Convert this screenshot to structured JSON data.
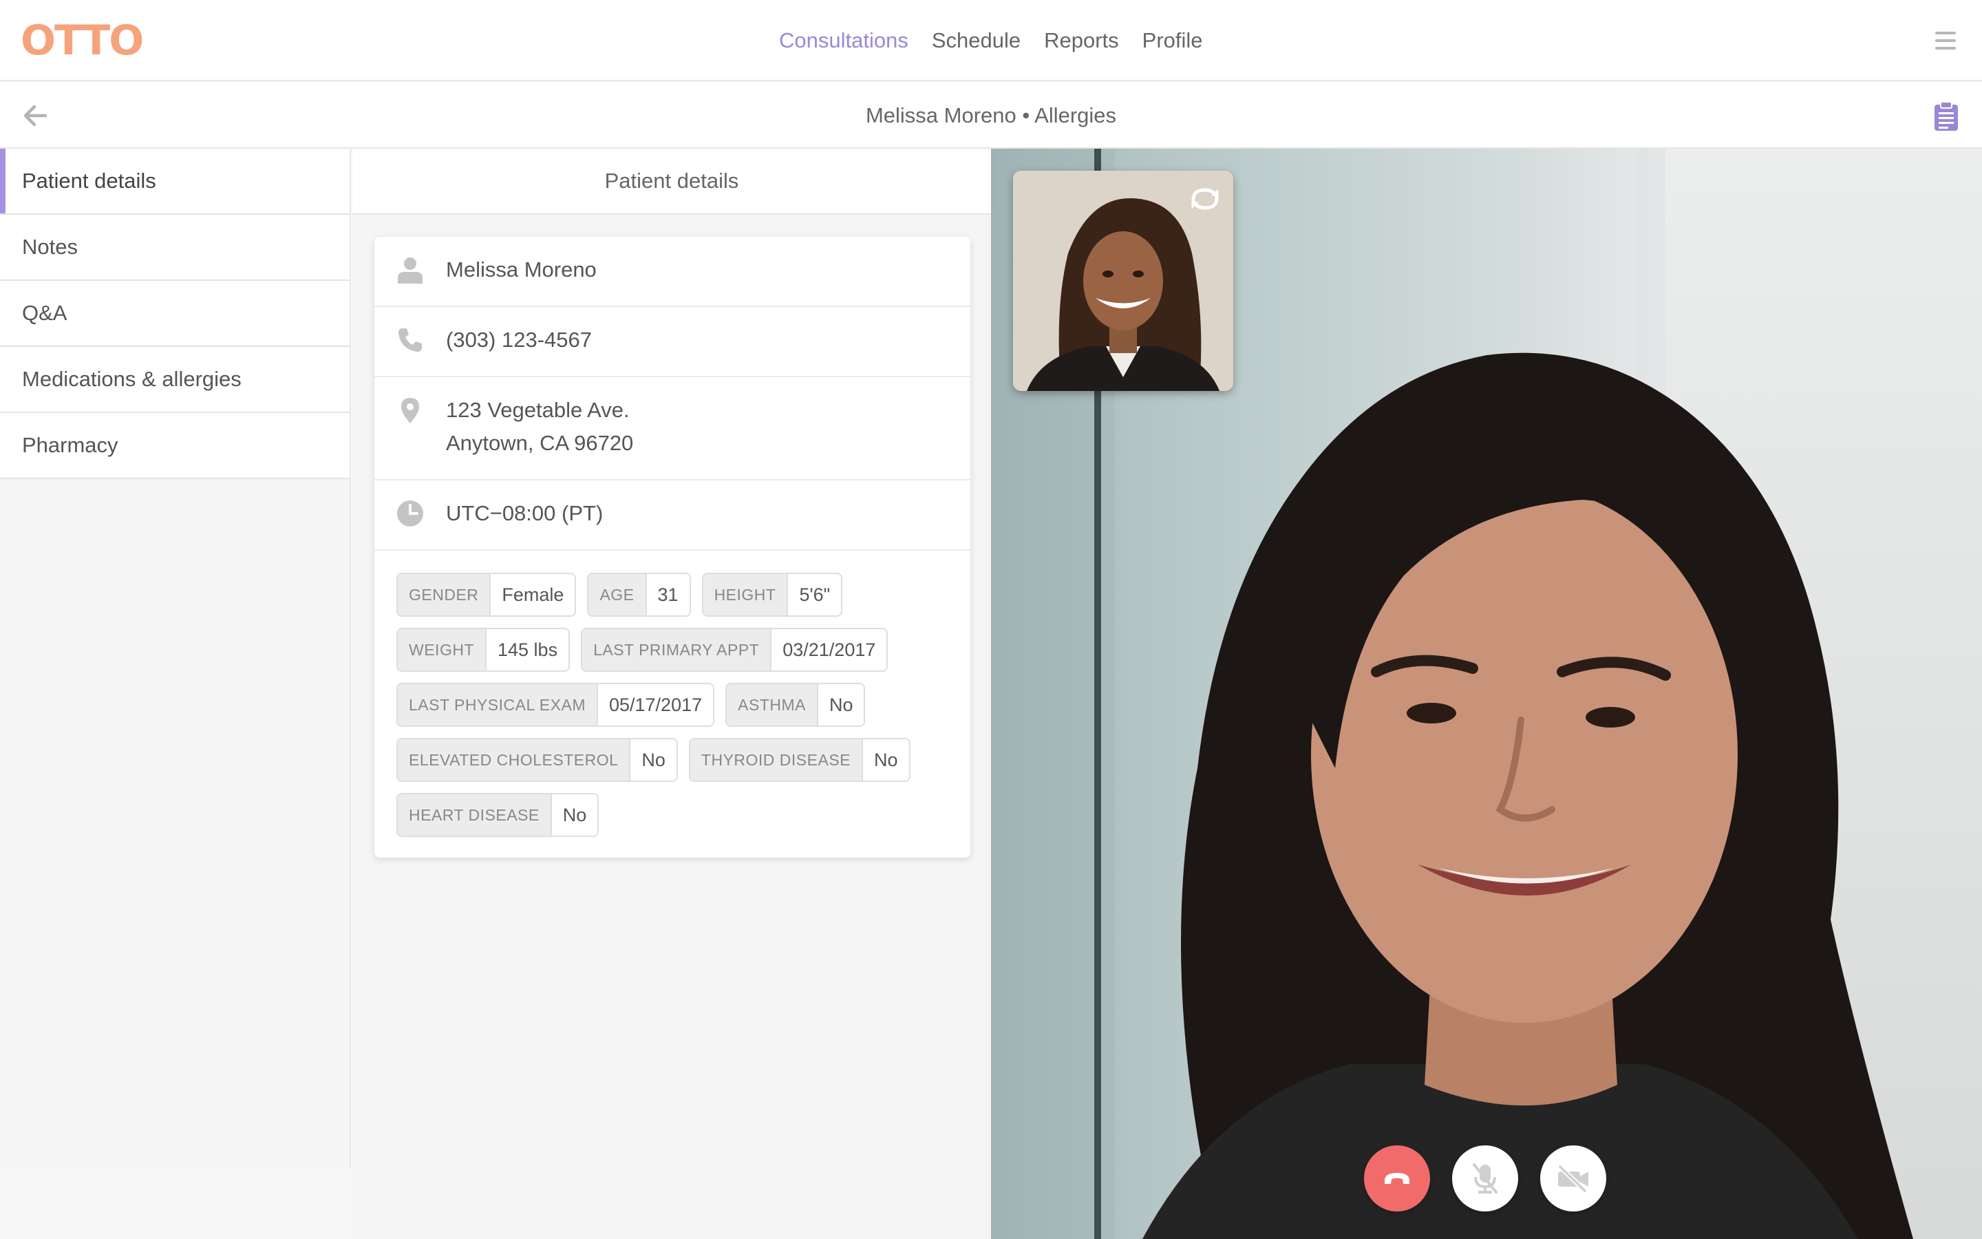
{
  "app": {
    "logo_text": "OTTO",
    "logo_color": "#f5a37d"
  },
  "nav": {
    "links": [
      {
        "label": "Consultations",
        "active": true
      },
      {
        "label": "Schedule",
        "active": false
      },
      {
        "label": "Reports",
        "active": false
      },
      {
        "label": "Profile",
        "active": false
      }
    ],
    "accent_color": "#9a88d6",
    "menu_icon": "hamburger-menu-icon"
  },
  "subheader": {
    "title": "Melissa Moreno • Allergies",
    "back_icon": "arrow-left-icon",
    "clipboard_icon": "clipboard-icon"
  },
  "sidebar": {
    "items": [
      {
        "label": "Patient details",
        "active": true
      },
      {
        "label": "Notes",
        "active": false
      },
      {
        "label": "Q&A",
        "active": false
      },
      {
        "label": "Medications & allergies",
        "active": false
      },
      {
        "label": "Pharmacy",
        "active": false
      }
    ]
  },
  "patient": {
    "panel_title": "Patient details",
    "name": "Melissa Moreno",
    "phone": "(303) 123-4567",
    "address_line1": "123 Vegetable Ave.",
    "address_line2": "Anytown, CA 96720",
    "timezone": "UTC−08:00 (PT)",
    "attributes": [
      {
        "label": "Gender",
        "value": "Female"
      },
      {
        "label": "Age",
        "value": "31"
      },
      {
        "label": "Height",
        "value": "5'6\""
      },
      {
        "label": "Weight",
        "value": "145 lbs"
      },
      {
        "label": "Last primary appt",
        "value": "03/21/2017"
      },
      {
        "label": "Last physical exam",
        "value": "05/17/2017"
      },
      {
        "label": "Asthma",
        "value": "No"
      },
      {
        "label": "Elevated cholesterol",
        "value": "No"
      },
      {
        "label": "Thyroid disease",
        "value": "No"
      },
      {
        "label": "Heart disease",
        "value": "No"
      }
    ]
  },
  "call": {
    "controls": [
      {
        "name": "end-call",
        "icon": "phone-hangup-icon",
        "color": "#f26b6b"
      },
      {
        "name": "mute-mic",
        "icon": "mic-off-icon"
      },
      {
        "name": "camera-off",
        "icon": "video-off-icon"
      }
    ],
    "pip_rotate_icon": "rotate-camera-icon"
  }
}
